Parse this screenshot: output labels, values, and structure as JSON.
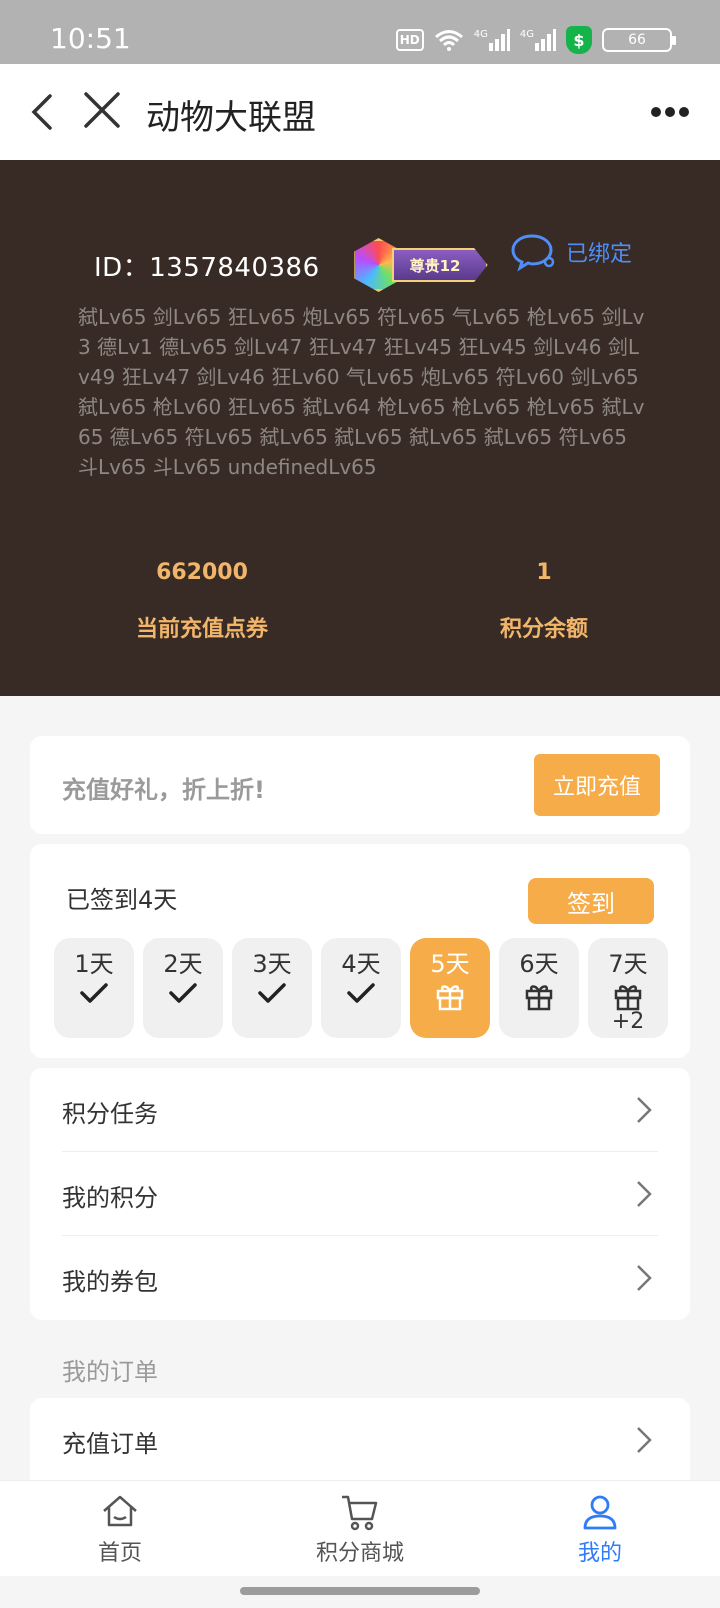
{
  "status_bar": {
    "time": "10:51",
    "hd_label": "HD",
    "net1": "4G",
    "net2": "4G",
    "shield_glyph": "$",
    "battery": "66"
  },
  "nav": {
    "title": "动物大联盟"
  },
  "profile": {
    "id_label": "ID",
    "id_value": "1357840386",
    "id_line": "ID：1357840386",
    "vip_label": "尊贵12",
    "bind_status": "已绑定",
    "levels_text": "弑Lv65 剑Lv65 狂Lv65 炮Lv65 符Lv65 气Lv65 枪Lv65 剑Lv3 德Lv1 德Lv65 剑Lv47 狂Lv47 狂Lv45 狂Lv45 剑Lv46 剑Lv49 狂Lv47 剑Lv46 狂Lv60 气Lv65 炮Lv65 符Lv60 剑Lv65 弑Lv65 枪Lv60 狂Lv65 弑Lv64 枪Lv65 枪Lv65 枪Lv65 弑Lv65 德Lv65 符Lv65 弑Lv65 弑Lv65 弑Lv65 弑Lv65 符Lv65 斗Lv65 斗Lv65 undefinedLv65",
    "recharge_points_value": "662000",
    "recharge_points_label": "当前充值点券",
    "score_balance_value": "1",
    "score_balance_label": "积分余额"
  },
  "promo": {
    "text": "充值好礼，折上折!",
    "button": "立即充值"
  },
  "signin": {
    "status": "已签到4天",
    "button": "签到",
    "days": [
      {
        "label": "1天",
        "state": "checked"
      },
      {
        "label": "2天",
        "state": "checked"
      },
      {
        "label": "3天",
        "state": "checked"
      },
      {
        "label": "4天",
        "state": "checked"
      },
      {
        "label": "5天",
        "state": "gift-active"
      },
      {
        "label": "6天",
        "state": "gift"
      },
      {
        "label": "7天",
        "state": "gift",
        "extra": "+2"
      }
    ]
  },
  "menu": {
    "items": [
      {
        "label": "积分任务"
      },
      {
        "label": "我的积分"
      },
      {
        "label": "我的券包"
      }
    ]
  },
  "orders": {
    "section_title": "我的订单",
    "item": "充值订单"
  },
  "tabbar": {
    "home": "首页",
    "mall": "积分商城",
    "mine": "我的"
  },
  "colors": {
    "accent": "#f6ac49",
    "hero_bg": "#382b25",
    "stat_text": "#f2b66a",
    "link_blue": "#4f8ef7",
    "tab_active": "#2f7cf6"
  }
}
